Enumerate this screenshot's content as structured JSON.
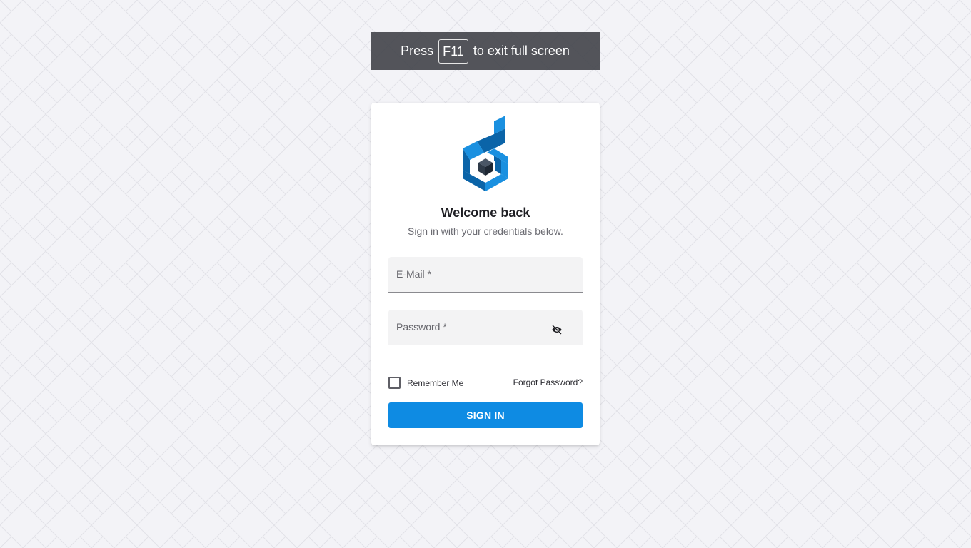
{
  "fullscreen_notice": {
    "prefix": "Press",
    "key": "F11",
    "suffix": "to exit full screen"
  },
  "login": {
    "logo_icon": "brand-cube-logo",
    "title": "Welcome back",
    "subtitle": "Sign in with your credentials below.",
    "email_label": "E-Mail *",
    "email_value": "",
    "password_label": "Password *",
    "password_value": "",
    "password_toggle_icon": "eye-off-icon",
    "remember_label": "Remember Me",
    "remember_checked": false,
    "forgot_label": "Forgot Password?",
    "submit_label": "SIGN IN"
  },
  "colors": {
    "background": "#f3f3f7",
    "accent": "#0e8be3",
    "logo_dark_blue": "#0b64a8",
    "logo_light_blue": "#1a90e0",
    "logo_cube": "#2f3a48"
  }
}
